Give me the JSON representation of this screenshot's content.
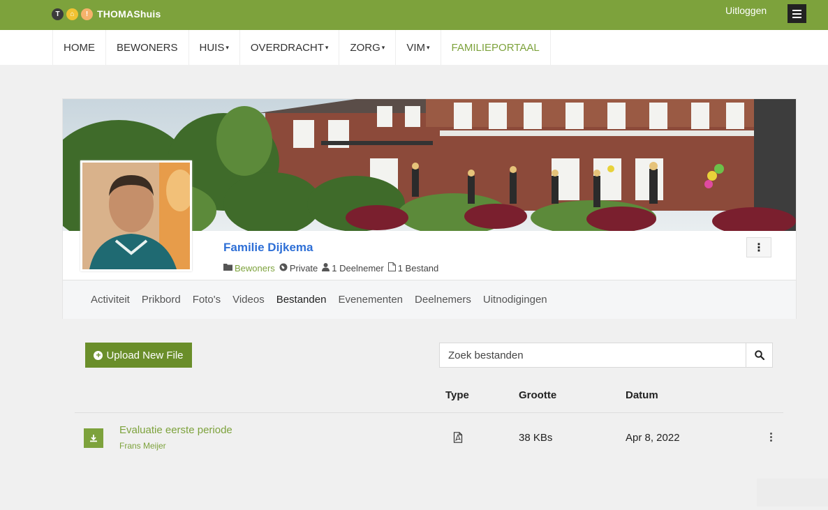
{
  "topbar": {
    "brand": "THOMAShuis",
    "logo_marks": [
      "T",
      "⌂",
      "!"
    ],
    "logout": "Uitloggen",
    "colors": {
      "bar": "#7da23c"
    }
  },
  "nav": {
    "items": [
      {
        "label": "HOME",
        "caret": ""
      },
      {
        "label": "BEWONERS",
        "caret": ""
      },
      {
        "label": "HUIS",
        "caret": "▾"
      },
      {
        "label": "OVERDRACHT",
        "caret": "▾"
      },
      {
        "label": "ZORG",
        "caret": "▾"
      },
      {
        "label": "VIM",
        "caret": "▾"
      },
      {
        "label": "FAMILIEPORTAAL",
        "caret": ""
      }
    ]
  },
  "group": {
    "name": "Familie Dijkema",
    "category": "Bewoners",
    "privacy": "Private",
    "members": "1 Deelnemer",
    "files": "1 Bestand",
    "menu_glyph": "⋮"
  },
  "tabs": [
    "Activiteit",
    "Prikbord",
    "Foto's",
    "Videos",
    "Bestanden",
    "Evenementen",
    "Deelnemers",
    "Uitnodigingen"
  ],
  "files": {
    "upload_label": "Upload New File",
    "search_placeholder": "Zoek bestanden",
    "columns": {
      "type": "Type",
      "size": "Grootte",
      "date": "Datum"
    },
    "rows": [
      {
        "name": "Evaluatie eerste periode",
        "owner": "Frans Meijer",
        "type_icon": "pdf-icon",
        "size": "38 KBs",
        "date": "Apr 8, 2022"
      }
    ]
  }
}
